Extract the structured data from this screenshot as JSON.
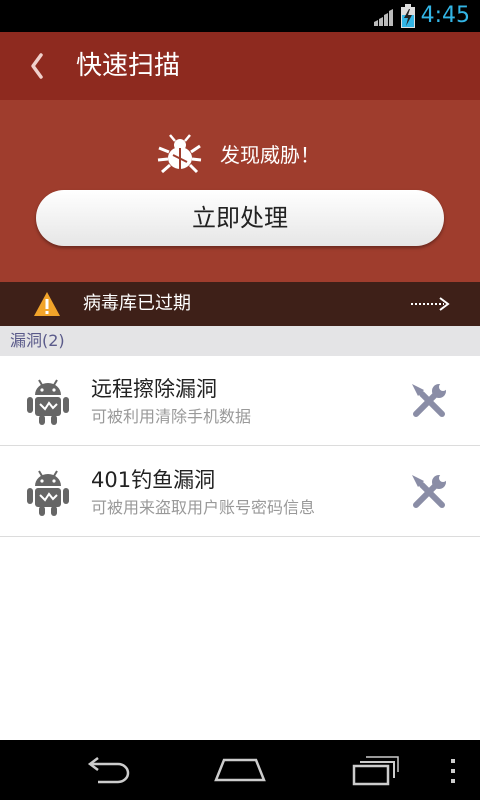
{
  "status_bar": {
    "time": "4:45",
    "signal_icon": "signal-icon",
    "battery_icon": "battery-charging-icon"
  },
  "header": {
    "title": "快速扫描",
    "back_icon": "chevron-left-icon"
  },
  "threat": {
    "label": "发现威胁！",
    "icon": "bug-icon",
    "action_label": "立即处理"
  },
  "warning": {
    "text": "病毒库已过期",
    "icon": "warning-icon",
    "arrow_icon": "dotted-arrow-right-icon"
  },
  "section": {
    "title": "漏洞(2)"
  },
  "vulnerabilities": [
    {
      "title": "远程擦除漏洞",
      "description": "可被利用清除手机数据",
      "icon": "android-icon",
      "action_icon": "tools-icon"
    },
    {
      "title": "401钓鱼漏洞",
      "description": "可被用来盗取用户账号密码信息",
      "icon": "android-icon",
      "action_icon": "tools-icon"
    }
  ],
  "nav_bar": {
    "back_icon": "back-icon",
    "home_icon": "home-icon",
    "recent_icon": "recent-apps-icon",
    "menu_icon": "overflow-menu-icon"
  },
  "colors": {
    "header": "#8e2a1f",
    "panel": "#9f3d2d",
    "warning_strip": "#3e2018",
    "clock": "#33b5e5",
    "section_text": "#5a5a8a"
  }
}
